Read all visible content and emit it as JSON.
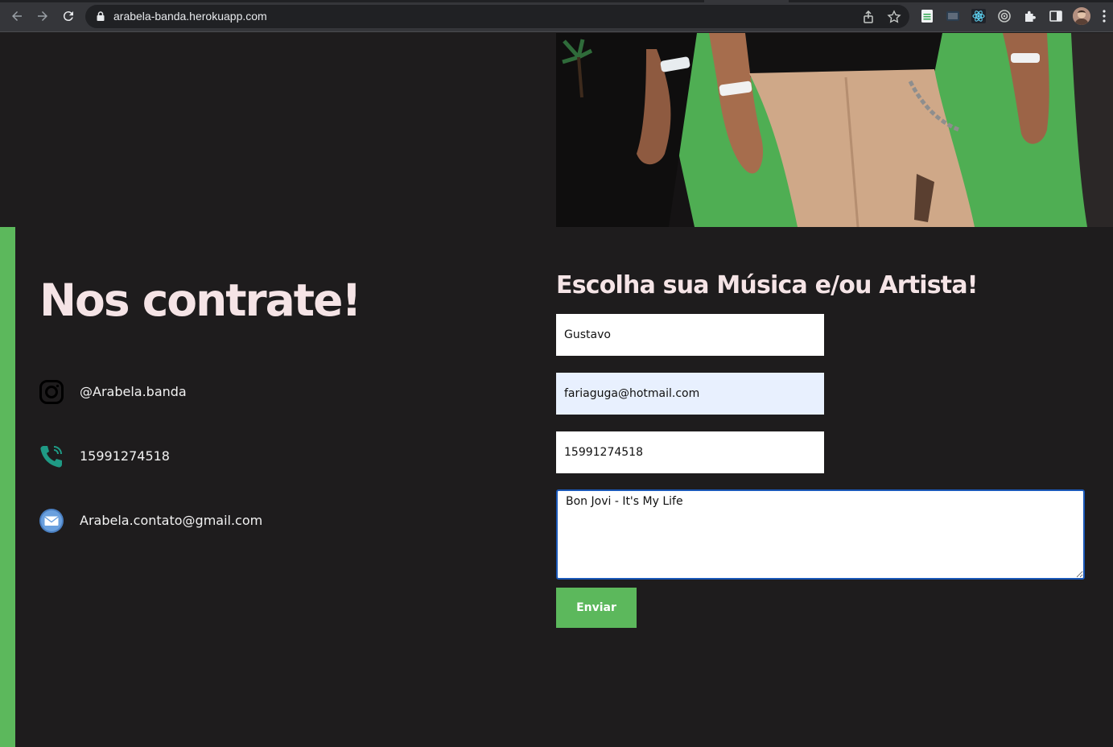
{
  "browser": {
    "url": "arabela-banda.herokuapp.com",
    "icons": [
      "back-arrow-icon",
      "forward-arrow-icon",
      "reload-icon",
      "lock-icon",
      "share-icon",
      "star-icon",
      "sheets-extension-icon",
      "cast-extension-icon",
      "react-devtools-icon",
      "target-extension-icon",
      "puzzle-extensions-icon",
      "sidebar-icon",
      "profile-avatar",
      "kebab-menu-icon"
    ]
  },
  "contact": {
    "title": "Nos contrate!",
    "items": [
      {
        "icon": "instagram-icon",
        "text": "@Arabela.banda"
      },
      {
        "icon": "phone-icon",
        "text": "15991274518"
      },
      {
        "icon": "email-icon",
        "text": "Arabela.contato@gmail.com"
      }
    ]
  },
  "form": {
    "title": "Escolha sua Música e/ou Artista!",
    "name_value": "Gustavo",
    "email_value": "fariaguga@hotmail.com",
    "phone_value": "15991274518",
    "message_value": "Bon Jovi - It's My Life",
    "submit_label": "Enviar"
  },
  "colors": {
    "background": "#1e1c1d",
    "accent_green": "#5cb85c",
    "title_pink": "#f5e4e6",
    "autofill_blue": "#e8f0fe",
    "focus_border": "#1a58b8"
  }
}
